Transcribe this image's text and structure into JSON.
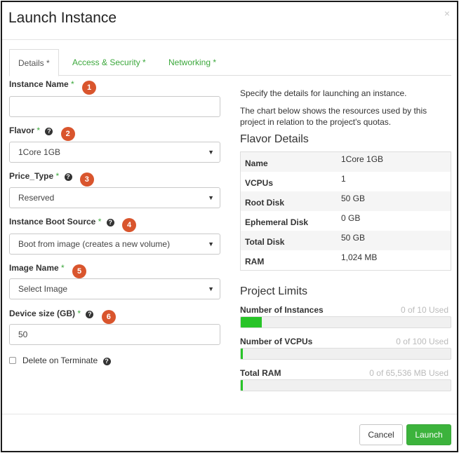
{
  "modal": {
    "title": "Launch Instance",
    "close_glyph": "×"
  },
  "tabs": [
    {
      "label": "Details *",
      "active": true
    },
    {
      "label": "Access & Security *",
      "active": false
    },
    {
      "label": "Networking *",
      "active": false
    }
  ],
  "form": {
    "instance_name": {
      "label": "Instance Name",
      "required": "*",
      "badge": "1",
      "value": ""
    },
    "flavor": {
      "label": "Flavor",
      "required": "*",
      "badge": "2",
      "value": "1Core 1GB"
    },
    "price_type": {
      "label": "Price_Type",
      "required": "*",
      "badge": "3",
      "value": "Reserved"
    },
    "boot_source": {
      "label": "Instance Boot Source",
      "required": "*",
      "badge": "4",
      "value": "Boot from image (creates a new volume)"
    },
    "image_name": {
      "label": "Image Name",
      "required": "*",
      "badge": "5",
      "value": "Select Image"
    },
    "device_size": {
      "label": "Device size (GB)",
      "required": "*",
      "badge": "6",
      "value": "50"
    },
    "delete_on_terminate": {
      "label": "Delete on Terminate",
      "checked": false
    },
    "help_glyph": "?",
    "dropdown_glyph": "▼"
  },
  "info": {
    "desc1": "Specify the details for launching an instance.",
    "desc2": "The chart below shows the resources used by this project in relation to the project's quotas.",
    "flavor_details_title": "Flavor Details",
    "flavor_details": [
      {
        "key": "Name",
        "value": "1Core 1GB"
      },
      {
        "key": "VCPUs",
        "value": "1"
      },
      {
        "key": "Root Disk",
        "value": "50 GB"
      },
      {
        "key": "Ephemeral Disk",
        "value": "0 GB"
      },
      {
        "key": "Total Disk",
        "value": "50 GB"
      },
      {
        "key": "RAM",
        "value": "1,024 MB"
      }
    ],
    "project_limits_title": "Project Limits",
    "limits": [
      {
        "label": "Number of Instances",
        "used_text": "0 of 10 Used",
        "fill": 0.1
      },
      {
        "label": "Number of VCPUs",
        "used_text": "0 of 100 Used",
        "fill": 0.01
      },
      {
        "label": "Total RAM",
        "used_text": "0 of 65,536 MB Used",
        "fill": 0.01
      }
    ]
  },
  "footer": {
    "cancel_label": "Cancel",
    "launch_label": "Launch"
  },
  "colors": {
    "accent": "#3cb33c",
    "badge": "#d9552d",
    "required": "#3ca83c"
  }
}
